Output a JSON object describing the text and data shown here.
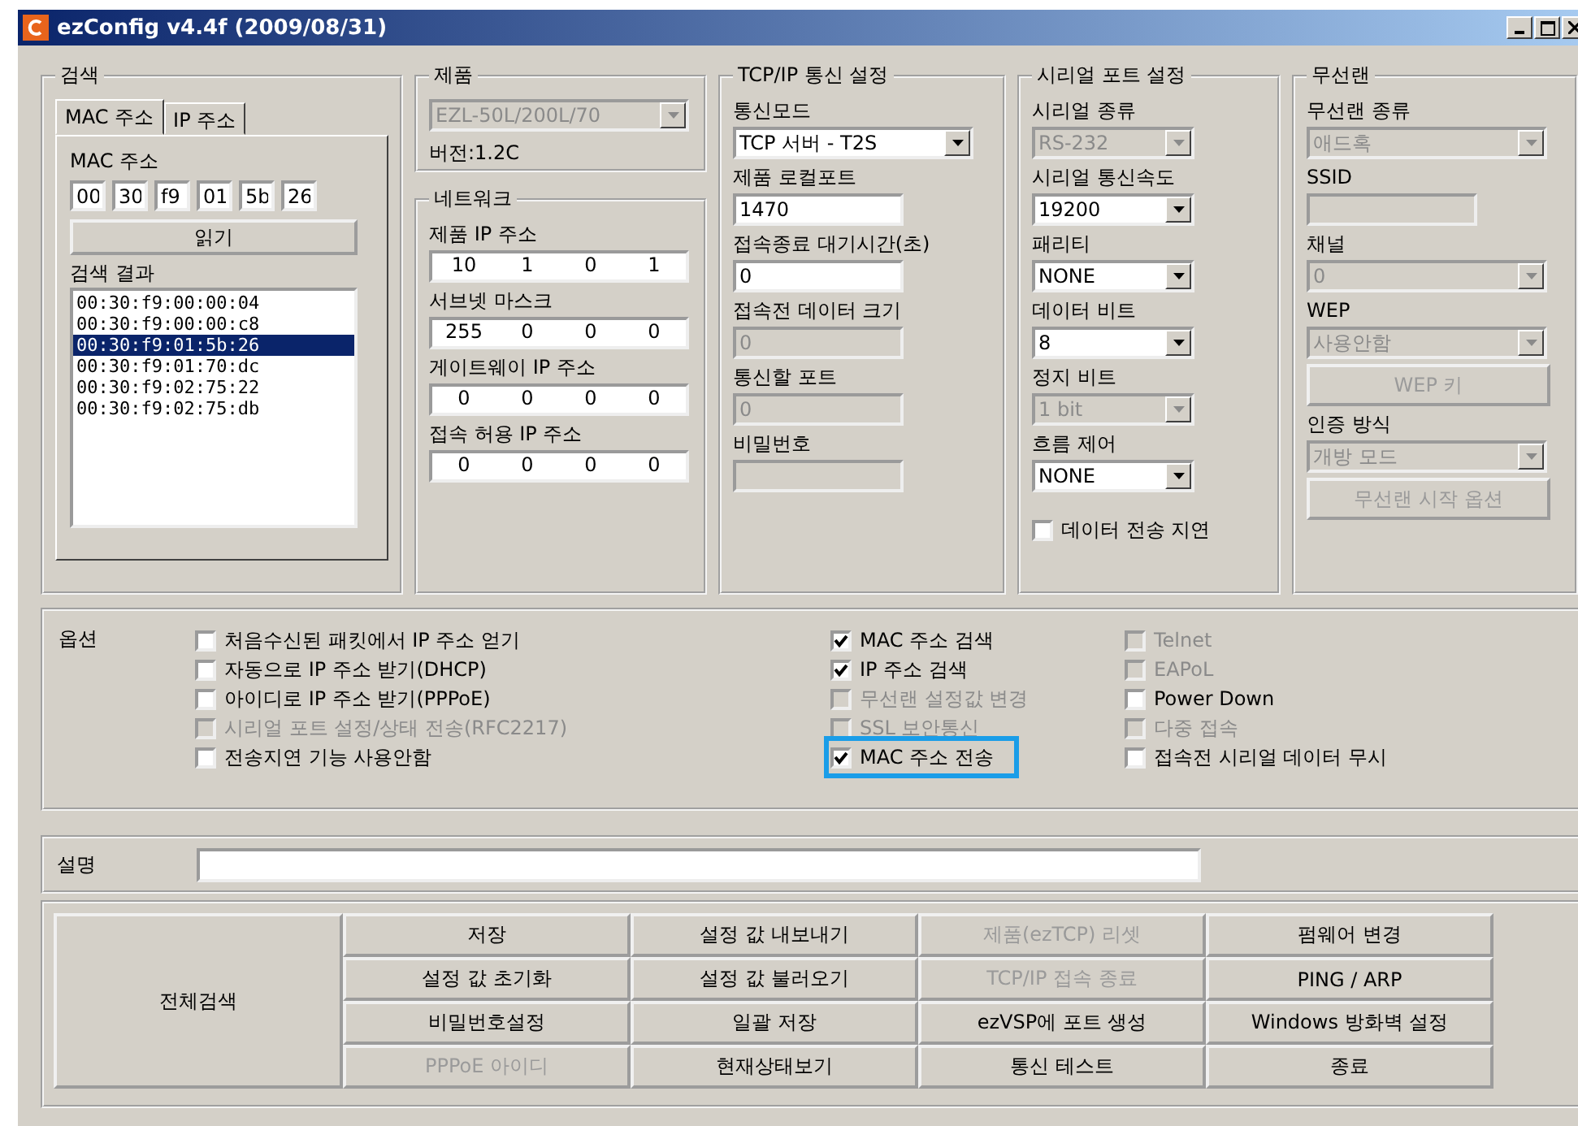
{
  "window": {
    "title": "ezConfig v4.4f (2009/08/31)"
  },
  "search": {
    "title": "검색",
    "tabs": [
      {
        "label": "MAC 주소",
        "selected": true
      },
      {
        "label": "IP 주소",
        "selected": false
      }
    ],
    "mac_label": "MAC 주소",
    "mac": [
      "00",
      "30",
      "f9",
      "01",
      "5b",
      "26"
    ],
    "read_button": "읽기",
    "results_label": "검색 결과",
    "results": [
      {
        "text": "00:30:f9:00:00:04",
        "selected": false
      },
      {
        "text": "00:30:f9:00:00:c8",
        "selected": false
      },
      {
        "text": "00:30:f9:01:5b:26",
        "selected": true
      },
      {
        "text": "00:30:f9:01:70:dc",
        "selected": false
      },
      {
        "text": "00:30:f9:02:75:22",
        "selected": false
      },
      {
        "text": "00:30:f9:02:75:db",
        "selected": false
      }
    ]
  },
  "product": {
    "title": "제품",
    "model": "EZL-50L/200L/70",
    "model_disabled": true,
    "version": "버전:1.2C"
  },
  "network": {
    "title": "네트워크",
    "fields": [
      {
        "label": "제품 IP 주소",
        "octets": [
          "10",
          "1",
          "0",
          "1"
        ]
      },
      {
        "label": "서브넷 마스크",
        "octets": [
          "255",
          "0",
          "0",
          "0"
        ]
      },
      {
        "label": "게이트웨이 IP 주소",
        "octets": [
          "0",
          "0",
          "0",
          "0"
        ]
      },
      {
        "label": "접속 허용 IP 주소",
        "octets": [
          "0",
          "0",
          "0",
          "0"
        ]
      }
    ]
  },
  "tcpip": {
    "title": "TCP/IP 통신 설정",
    "fields": [
      {
        "label": "통신모드",
        "kind": "select",
        "value": "TCP 서버 - T2S",
        "disabled": false
      },
      {
        "label": "제품 로컬포트",
        "kind": "text",
        "value": "1470",
        "disabled": false
      },
      {
        "label": "접속종료 대기시간(초)",
        "kind": "text",
        "value": "0",
        "disabled": false
      },
      {
        "label": "접속전 데이터 크기",
        "kind": "text",
        "value": "0",
        "disabled": true
      },
      {
        "label": "통신할 포트",
        "kind": "text",
        "value": "0",
        "disabled": true
      },
      {
        "label": "비밀번호",
        "kind": "text",
        "disabled": true
      }
    ]
  },
  "serial": {
    "title": "시리얼 포트 설정",
    "fields": [
      {
        "label": "시리얼 종류",
        "kind": "select",
        "value": "RS-232",
        "disabled": true
      },
      {
        "label": "시리얼 통신속도",
        "kind": "select",
        "value": "19200",
        "disabled": false
      },
      {
        "label": "패리티",
        "kind": "select",
        "value": "NONE",
        "disabled": false
      },
      {
        "label": "데이터 비트",
        "kind": "select",
        "value": "8",
        "disabled": false
      },
      {
        "label": "정지 비트",
        "kind": "select",
        "value": "1 bit",
        "disabled": true
      },
      {
        "label": "흐름 제어",
        "kind": "select",
        "value": "NONE",
        "disabled": false
      }
    ],
    "delay": {
      "label": "데이터 전송 지연",
      "checked": false
    }
  },
  "wireless": {
    "title": "무선랜",
    "fields": [
      {
        "label": "무선랜 종류",
        "kind": "select",
        "value": "애드혹",
        "disabled": true
      },
      {
        "label": "SSID",
        "kind": "text",
        "disabled": true
      },
      {
        "label": "채널",
        "kind": "select",
        "value": "0",
        "disabled": true
      },
      {
        "label": "WEP",
        "kind": "select",
        "value": "사용안함",
        "disabled": true
      },
      {
        "label": "WEP 키",
        "kind": "button",
        "disabled": true
      },
      {
        "label": "인증 방식",
        "kind": "select",
        "value": "개방 모드",
        "disabled": true
      },
      {
        "label": "무선랜 시작 옵션",
        "kind": "button",
        "disabled": true
      }
    ]
  },
  "options": {
    "title": "옵션",
    "columns": [
      [
        {
          "label": "처음수신된 패킷에서 IP 주소 얻기",
          "checked": false,
          "disabled": false,
          "highlighted": false
        },
        {
          "label": "자동으로 IP 주소 받기(DHCP)",
          "checked": false,
          "disabled": false,
          "highlighted": false
        },
        {
          "label": "아이디로 IP 주소 받기(PPPoE)",
          "checked": false,
          "disabled": false,
          "highlighted": false
        },
        {
          "label": "시리얼 포트 설정/상태 전송(RFC2217)",
          "checked": false,
          "disabled": true,
          "highlighted": false
        },
        {
          "label": "전송지연 기능 사용안함",
          "checked": false,
          "disabled": false,
          "highlighted": false
        }
      ],
      [
        {
          "label": "MAC 주소 검색",
          "checked": true,
          "disabled": false,
          "highlighted": false
        },
        {
          "label": "IP 주소 검색",
          "checked": true,
          "disabled": false,
          "highlighted": false
        },
        {
          "label": "무선랜 설정값 변경",
          "checked": false,
          "disabled": true,
          "highlighted": false
        },
        {
          "label": "SSL 보안통신",
          "checked": false,
          "disabled": true,
          "highlighted": false
        },
        {
          "label": "MAC 주소 전송",
          "checked": true,
          "disabled": false,
          "highlighted": true
        }
      ],
      [
        {
          "label": "Telnet",
          "checked": false,
          "disabled": true,
          "highlighted": false
        },
        {
          "label": "EAPoL",
          "checked": false,
          "disabled": true,
          "highlighted": false
        },
        {
          "label": "Power Down",
          "checked": false,
          "disabled": false,
          "highlighted": false
        },
        {
          "label": "다중 접속",
          "checked": false,
          "disabled": true,
          "highlighted": false
        },
        {
          "label": "접속전 시리얼 데이터 무시",
          "checked": false,
          "disabled": false,
          "highlighted": false
        }
      ]
    ]
  },
  "description": {
    "label": "설명"
  },
  "actions": {
    "main": "전체검색",
    "buttons": [
      {
        "label": "저장",
        "disabled": false
      },
      {
        "label": "설정 값 내보내기",
        "disabled": false
      },
      {
        "label": "제품(ezTCP) 리셋",
        "disabled": true
      },
      {
        "label": "펌웨어 변경",
        "disabled": false
      },
      {
        "label": "설정 값 초기화",
        "disabled": false
      },
      {
        "label": "설정 값 불러오기",
        "disabled": false
      },
      {
        "label": "TCP/IP 접속 종료",
        "disabled": true
      },
      {
        "label": "PING / ARP",
        "disabled": false
      },
      {
        "label": "비밀번호설정",
        "disabled": false
      },
      {
        "label": "일괄 저장",
        "disabled": false
      },
      {
        "label": "ezVSP에 포트 생성",
        "disabled": false
      },
      {
        "label": "Windows 방화벽 설정",
        "disabled": false
      },
      {
        "label": "PPPoE 아이디",
        "disabled": true
      },
      {
        "label": "현재상태보기",
        "disabled": false
      },
      {
        "label": "통신 테스트",
        "disabled": false
      },
      {
        "label": "종료",
        "disabled": false
      }
    ]
  }
}
